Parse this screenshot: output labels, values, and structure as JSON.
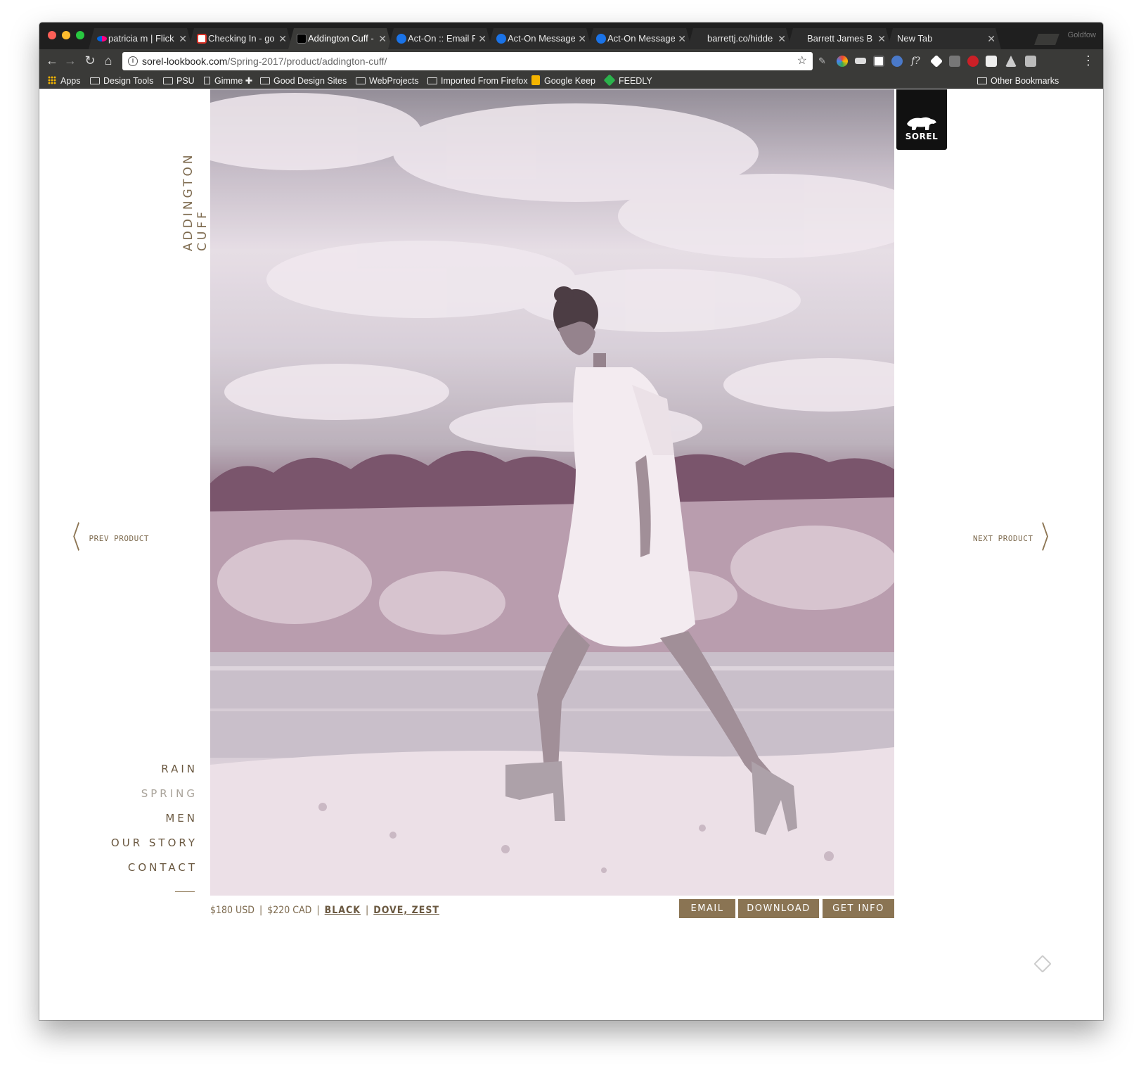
{
  "browser": {
    "tabs": [
      {
        "title": "patricia m | Flick",
        "favicon_color": "#ff0084"
      },
      {
        "title": "Checking In - go",
        "favicon_color": "#d93025"
      },
      {
        "title": "Addington Cuff -",
        "favicon_color": "#000000"
      },
      {
        "title": "Act-On :: Email F",
        "favicon_color": "#1a73e8"
      },
      {
        "title": "Act-On Message",
        "favicon_color": "#1a73e8"
      },
      {
        "title": "Act-On Message",
        "favicon_color": "#1a73e8"
      },
      {
        "title": "barrettj.co/hidde",
        "favicon_color": "#2c2c2c"
      },
      {
        "title": "Barrett James B",
        "favicon_color": "#2c2c2c"
      },
      {
        "title": "New Tab",
        "favicon_color": "#2c2c2c"
      }
    ],
    "active_tab_index": 2,
    "profile": "Goldfow",
    "url_domain": "sorel-lookbook.com",
    "url_path": "/Spring-2017/product/addington-cuff/",
    "bookmarks": [
      {
        "label": "Apps",
        "icon": "apps-grid-icon"
      },
      {
        "label": "Design Tools",
        "icon": "folder-icon"
      },
      {
        "label": "PSU",
        "icon": "folder-icon"
      },
      {
        "label": "Gimme ✚",
        "icon": "page-icon"
      },
      {
        "label": "Good Design Sites",
        "icon": "folder-icon"
      },
      {
        "label": "WebProjects",
        "icon": "folder-icon"
      },
      {
        "label": "Imported From Firefox",
        "icon": "folder-icon"
      },
      {
        "label": "Google Keep",
        "icon": "keep-icon"
      },
      {
        "label": "FEEDLY",
        "icon": "feedly-icon"
      }
    ],
    "other_bookmarks": "Other Bookmarks"
  },
  "page": {
    "product_title": "ADDINGTON CUFF",
    "logo_text": "SOREL",
    "prev_label": "PREV PRODUCT",
    "next_label": "NEXT PRODUCT",
    "nav": [
      {
        "label": "RAIN",
        "active": false
      },
      {
        "label": "SPRING",
        "active": true
      },
      {
        "label": "MEN",
        "active": false
      },
      {
        "label": "OUR STORY",
        "active": false
      },
      {
        "label": "CONTACT",
        "active": false
      }
    ],
    "price_usd": "$180 USD",
    "price_cad": "$220 CAD",
    "color_primary": "BLACK",
    "color_alternates": "DOVE, ZEST",
    "buttons": {
      "email": "EMAIL",
      "download": "DOWNLOAD",
      "get_info": "GET INFO"
    },
    "accent_color": "#8a7453"
  }
}
